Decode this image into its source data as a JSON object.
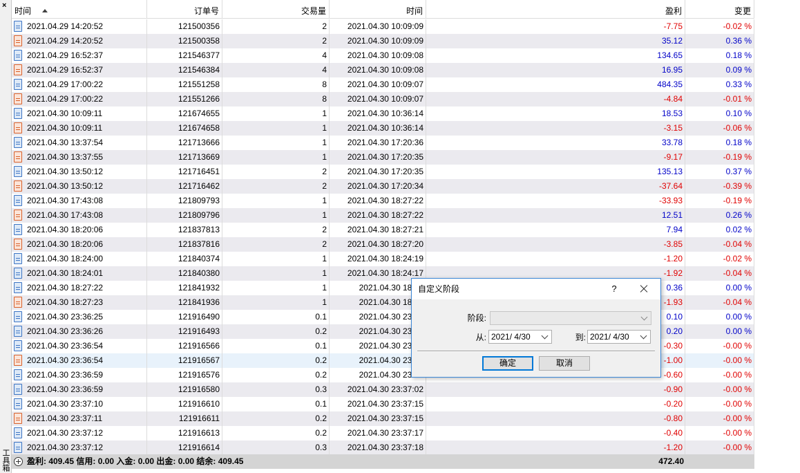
{
  "side_panel": {
    "close_glyph": "×",
    "label": "工具箱"
  },
  "columns": {
    "time": "时间",
    "order": "订单号",
    "volume": "交易量",
    "close_time": "时间",
    "profit": "盈利",
    "change": "变更"
  },
  "sort": {
    "column": "time",
    "direction": "ascending",
    "icon": "sort-ascending-icon"
  },
  "rows": [
    {
      "time": "2021.04.29 14:20:52",
      "order": "121500356",
      "volume": "2",
      "close_time": "2021.04.30 10:09:09",
      "profit": "-7.75",
      "change": "-0.02 %",
      "type": "buy"
    },
    {
      "time": "2021.04.29 14:20:52",
      "order": "121500358",
      "volume": "2",
      "close_time": "2021.04.30 10:09:09",
      "profit": "35.12",
      "change": "0.36 %",
      "type": "sell"
    },
    {
      "time": "2021.04.29 16:52:37",
      "order": "121546377",
      "volume": "4",
      "close_time": "2021.04.30 10:09:08",
      "profit": "134.65",
      "change": "0.18 %",
      "type": "buy"
    },
    {
      "time": "2021.04.29 16:52:37",
      "order": "121546384",
      "volume": "4",
      "close_time": "2021.04.30 10:09:08",
      "profit": "16.95",
      "change": "0.09 %",
      "type": "sell"
    },
    {
      "time": "2021.04.29 17:00:22",
      "order": "121551258",
      "volume": "8",
      "close_time": "2021.04.30 10:09:07",
      "profit": "484.35",
      "change": "0.33 %",
      "type": "buy"
    },
    {
      "time": "2021.04.29 17:00:22",
      "order": "121551266",
      "volume": "8",
      "close_time": "2021.04.30 10:09:07",
      "profit": "-4.84",
      "change": "-0.01 %",
      "type": "sell"
    },
    {
      "time": "2021.04.30 10:09:11",
      "order": "121674655",
      "volume": "1",
      "close_time": "2021.04.30 10:36:14",
      "profit": "18.53",
      "change": "0.10 %",
      "type": "buy"
    },
    {
      "time": "2021.04.30 10:09:11",
      "order": "121674658",
      "volume": "1",
      "close_time": "2021.04.30 10:36:14",
      "profit": "-3.15",
      "change": "-0.06 %",
      "type": "sell"
    },
    {
      "time": "2021.04.30 13:37:54",
      "order": "121713666",
      "volume": "1",
      "close_time": "2021.04.30 17:20:36",
      "profit": "33.78",
      "change": "0.18 %",
      "type": "buy"
    },
    {
      "time": "2021.04.30 13:37:55",
      "order": "121713669",
      "volume": "1",
      "close_time": "2021.04.30 17:20:35",
      "profit": "-9.17",
      "change": "-0.19 %",
      "type": "sell"
    },
    {
      "time": "2021.04.30 13:50:12",
      "order": "121716451",
      "volume": "2",
      "close_time": "2021.04.30 17:20:35",
      "profit": "135.13",
      "change": "0.37 %",
      "type": "buy"
    },
    {
      "time": "2021.04.30 13:50:12",
      "order": "121716462",
      "volume": "2",
      "close_time": "2021.04.30 17:20:34",
      "profit": "-37.64",
      "change": "-0.39 %",
      "type": "sell"
    },
    {
      "time": "2021.04.30 17:43:08",
      "order": "121809793",
      "volume": "1",
      "close_time": "2021.04.30 18:27:22",
      "profit": "-33.93",
      "change": "-0.19 %",
      "type": "buy"
    },
    {
      "time": "2021.04.30 17:43:08",
      "order": "121809796",
      "volume": "1",
      "close_time": "2021.04.30 18:27:22",
      "profit": "12.51",
      "change": "0.26 %",
      "type": "sell"
    },
    {
      "time": "2021.04.30 18:20:06",
      "order": "121837813",
      "volume": "2",
      "close_time": "2021.04.30 18:27:21",
      "profit": "7.94",
      "change": "0.02 %",
      "type": "buy"
    },
    {
      "time": "2021.04.30 18:20:06",
      "order": "121837816",
      "volume": "2",
      "close_time": "2021.04.30 18:27:20",
      "profit": "-3.85",
      "change": "-0.04 %",
      "type": "sell"
    },
    {
      "time": "2021.04.30 18:24:00",
      "order": "121840374",
      "volume": "1",
      "close_time": "2021.04.30 18:24:19",
      "profit": "-1.20",
      "change": "-0.02 %",
      "type": "buy"
    },
    {
      "time": "2021.04.30 18:24:01",
      "order": "121840380",
      "volume": "1",
      "close_time": "2021.04.30 18:24:17",
      "profit": "-1.92",
      "change": "-0.04 %",
      "type": "buy"
    },
    {
      "time": "2021.04.30 18:27:22",
      "order": "121841932",
      "volume": "1",
      "close_time": "2021.04.30 18:27",
      "profit": "0.36",
      "change": "0.00 %",
      "type": "buy"
    },
    {
      "time": "2021.04.30 18:27:23",
      "order": "121841936",
      "volume": "1",
      "close_time": "2021.04.30 18:27",
      "profit": "-1.93",
      "change": "-0.04 %",
      "type": "sell"
    },
    {
      "time": "2021.04.30 23:36:25",
      "order": "121916490",
      "volume": "0.1",
      "close_time": "2021.04.30 23:36",
      "profit": "0.10",
      "change": "0.00 %",
      "type": "buy"
    },
    {
      "time": "2021.04.30 23:36:26",
      "order": "121916493",
      "volume": "0.2",
      "close_time": "2021.04.30 23:36",
      "profit": "0.20",
      "change": "0.00 %",
      "type": "buy"
    },
    {
      "time": "2021.04.30 23:36:54",
      "order": "121916566",
      "volume": "0.1",
      "close_time": "2021.04.30 23:37",
      "profit": "-0.30",
      "change": "-0.00 %",
      "type": "buy"
    },
    {
      "time": "2021.04.30 23:36:54",
      "order": "121916567",
      "volume": "0.2",
      "close_time": "2021.04.30 23:37",
      "profit": "-1.00",
      "change": "-0.00 %",
      "type": "sell",
      "selected": true
    },
    {
      "time": "2021.04.30 23:36:59",
      "order": "121916576",
      "volume": "0.2",
      "close_time": "2021.04.30 23:37",
      "profit": "-0.60",
      "change": "-0.00 %",
      "type": "buy"
    },
    {
      "time": "2021.04.30 23:36:59",
      "order": "121916580",
      "volume": "0.3",
      "close_time": "2021.04.30 23:37:02",
      "profit": "-0.90",
      "change": "-0.00 %",
      "type": "buy"
    },
    {
      "time": "2021.04.30 23:37:10",
      "order": "121916610",
      "volume": "0.1",
      "close_time": "2021.04.30 23:37:15",
      "profit": "-0.20",
      "change": "-0.00 %",
      "type": "buy"
    },
    {
      "time": "2021.04.30 23:37:11",
      "order": "121916611",
      "volume": "0.2",
      "close_time": "2021.04.30 23:37:15",
      "profit": "-0.80",
      "change": "-0.00 %",
      "type": "sell"
    },
    {
      "time": "2021.04.30 23:37:12",
      "order": "121916613",
      "volume": "0.2",
      "close_time": "2021.04.30 23:37:17",
      "profit": "-0.40",
      "change": "-0.00 %",
      "type": "buy"
    },
    {
      "time": "2021.04.30 23:37:12",
      "order": "121916614",
      "volume": "0.3",
      "close_time": "2021.04.30 23:37:18",
      "profit": "-1.20",
      "change": "-0.00 %",
      "type": "buy"
    }
  ],
  "footer": {
    "summary": "盈利: 409.45  信用: 0.00  入金: 0.00  出金: 0.00  结余: 409.45",
    "total_profit": "472.40"
  },
  "dialog": {
    "title": "自定义阶段",
    "help_glyph": "?",
    "period_label": "阶段:",
    "period_value": "",
    "from_label": "从:",
    "from_value": "2021/  4/30",
    "to_label": "到:",
    "to_value": "2021/  4/30",
    "ok_label": "确定",
    "cancel_label": "取消"
  },
  "colors": {
    "positive": "#0000c8",
    "negative": "#e00000",
    "row_even": "#ebeaef",
    "row_selected": "#e8f2fb",
    "footer_bg": "#d4d4d4",
    "dialog_border": "#3b86d6"
  }
}
